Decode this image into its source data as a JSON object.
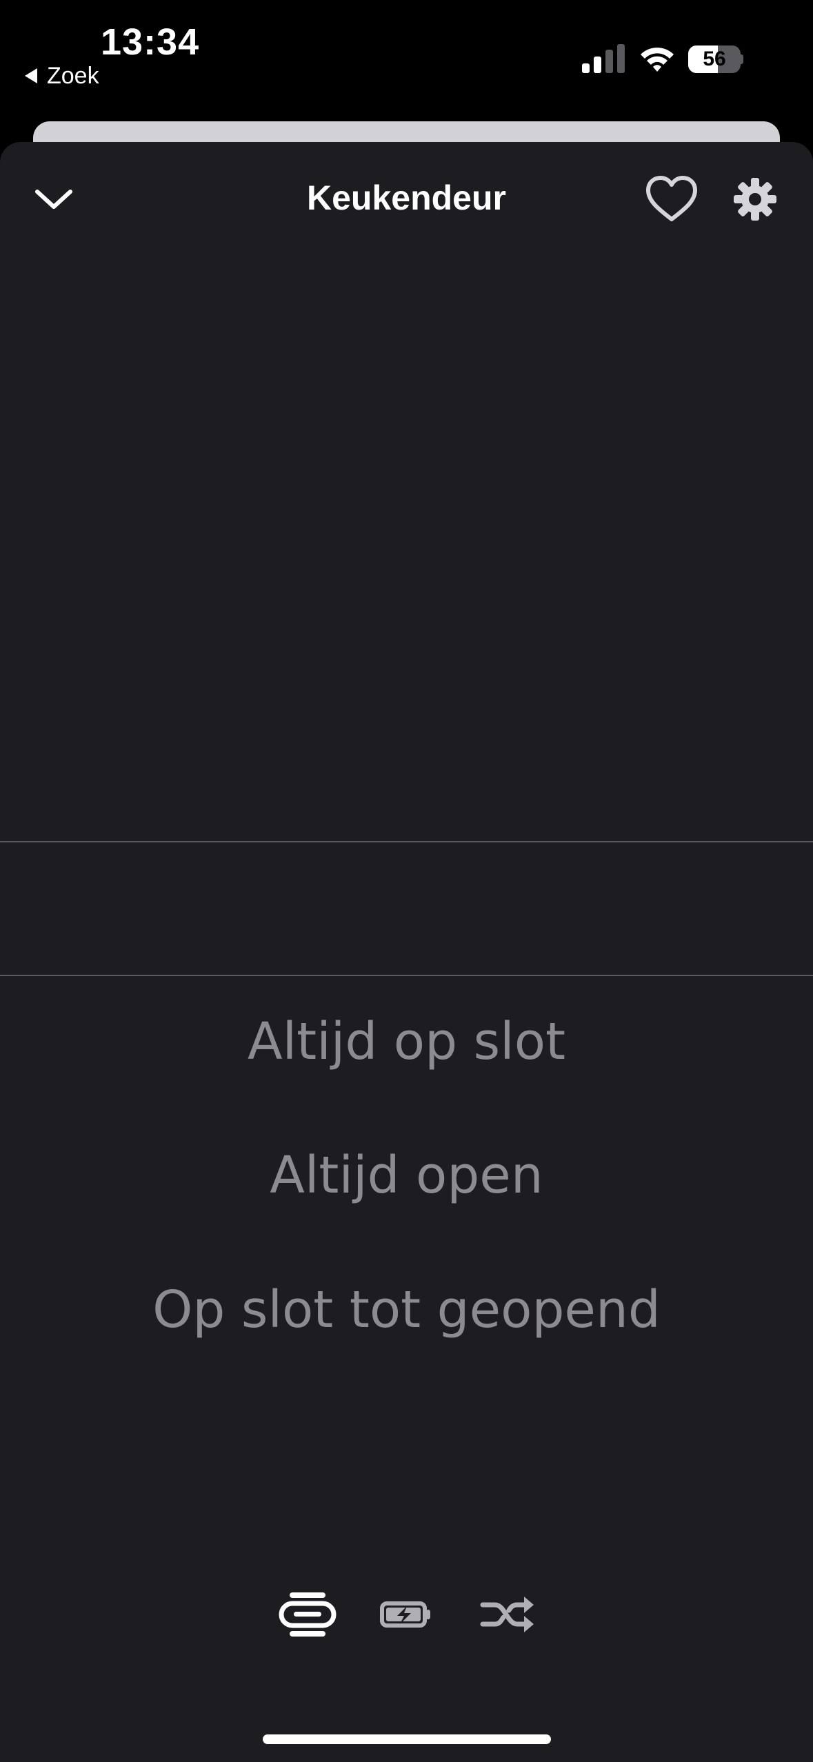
{
  "status_bar": {
    "time": "13:34",
    "back_label": "Zoek",
    "battery_level": "56",
    "battery_fraction": 0.56
  },
  "header": {
    "title": "Keukendeur",
    "icons": [
      "chevron-down-icon",
      "heart-icon",
      "gear-icon"
    ]
  },
  "picker": {
    "options": [
      "Altijd op slot",
      "Altijd open",
      "Op slot tot geopend"
    ]
  },
  "bottom_bar": {
    "icons": [
      "lines-icon",
      "battery-charging-icon",
      "shuffle-icon"
    ]
  },
  "colors": {
    "background": "#000000",
    "sheet": "#1c1c21",
    "option_text": "#8b8b90",
    "icon_active": "#ffffff",
    "icon_inactive": "#b0b0b4"
  }
}
